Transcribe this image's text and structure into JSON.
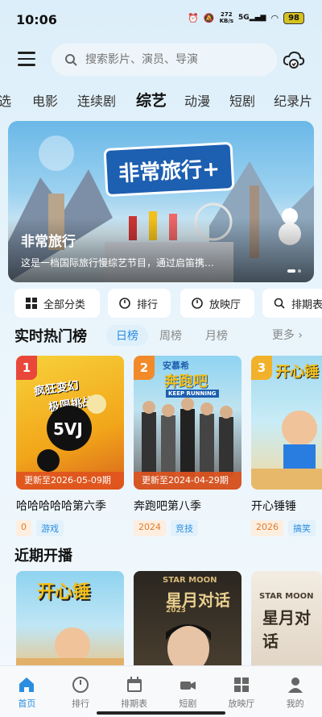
{
  "status": {
    "time": "10:06",
    "speed_value": "272",
    "speed_unit": "KB/s",
    "network": "5G",
    "battery": "98"
  },
  "search": {
    "placeholder": "搜索影片、演员、导演"
  },
  "categories": [
    "精选",
    "电影",
    "连续剧",
    "综艺",
    "动漫",
    "短剧",
    "纪录片"
  ],
  "categories_display": [
    "选",
    "电影",
    "连续剧",
    "综艺",
    "动漫",
    "短剧",
    "纪录片"
  ],
  "active_category": "综艺",
  "banner": {
    "title": "非常旅行",
    "logo_text": "非常旅行+",
    "description": "这是一档国际旅行慢综艺节目，通过启笛携…"
  },
  "quick_actions": [
    {
      "label": "全部分类",
      "icon": "grid-icon"
    },
    {
      "label": "排行",
      "icon": "circle-icon"
    },
    {
      "label": "放映厅",
      "icon": "circle-icon"
    },
    {
      "label": "排期表",
      "icon": "search-icon"
    }
  ],
  "hot": {
    "title": "实时热门榜",
    "tabs": [
      "日榜",
      "周榜",
      "月榜"
    ],
    "active_tab": "日榜",
    "more": "更多",
    "items": [
      {
        "rank": "1",
        "title": "哈哈哈哈哈第六季",
        "update": "更新至2026-05-09期",
        "tags": [
          "0",
          "游戏"
        ],
        "rank_color": "#e8473a"
      },
      {
        "rank": "2",
        "title": "奔跑吧第八季",
        "update": "更新至2024-04-29期",
        "tags": [
          "2024",
          "竞技"
        ],
        "rank_color": "#f28a2a"
      },
      {
        "rank": "3",
        "title": "开心锤锤",
        "update": "",
        "tags": [
          "2026",
          "搞笑"
        ],
        "rank_color": "#f2b12a"
      }
    ]
  },
  "upcoming": {
    "title": "近期开播"
  },
  "nav": [
    {
      "label": "首页",
      "icon": "home-icon"
    },
    {
      "label": "排行",
      "icon": "ranking-icon"
    },
    {
      "label": "排期表",
      "icon": "calendar-icon"
    },
    {
      "label": "短剧",
      "icon": "video-icon"
    },
    {
      "label": "放映厅",
      "icon": "grid-icon"
    },
    {
      "label": "我的",
      "icon": "user-icon"
    }
  ],
  "poster_text": {
    "p1_line1": "疯狂变幻",
    "p1_line2": "极限挑战",
    "p2_top": "安慕希",
    "p2_logo": "奔跑吧",
    "p2_sub": "KEEP RUNNING",
    "p3_logo": "开心锤",
    "u2_brand": "STAR MOON",
    "u2_title": "星月对话",
    "u2_year": "2023"
  }
}
